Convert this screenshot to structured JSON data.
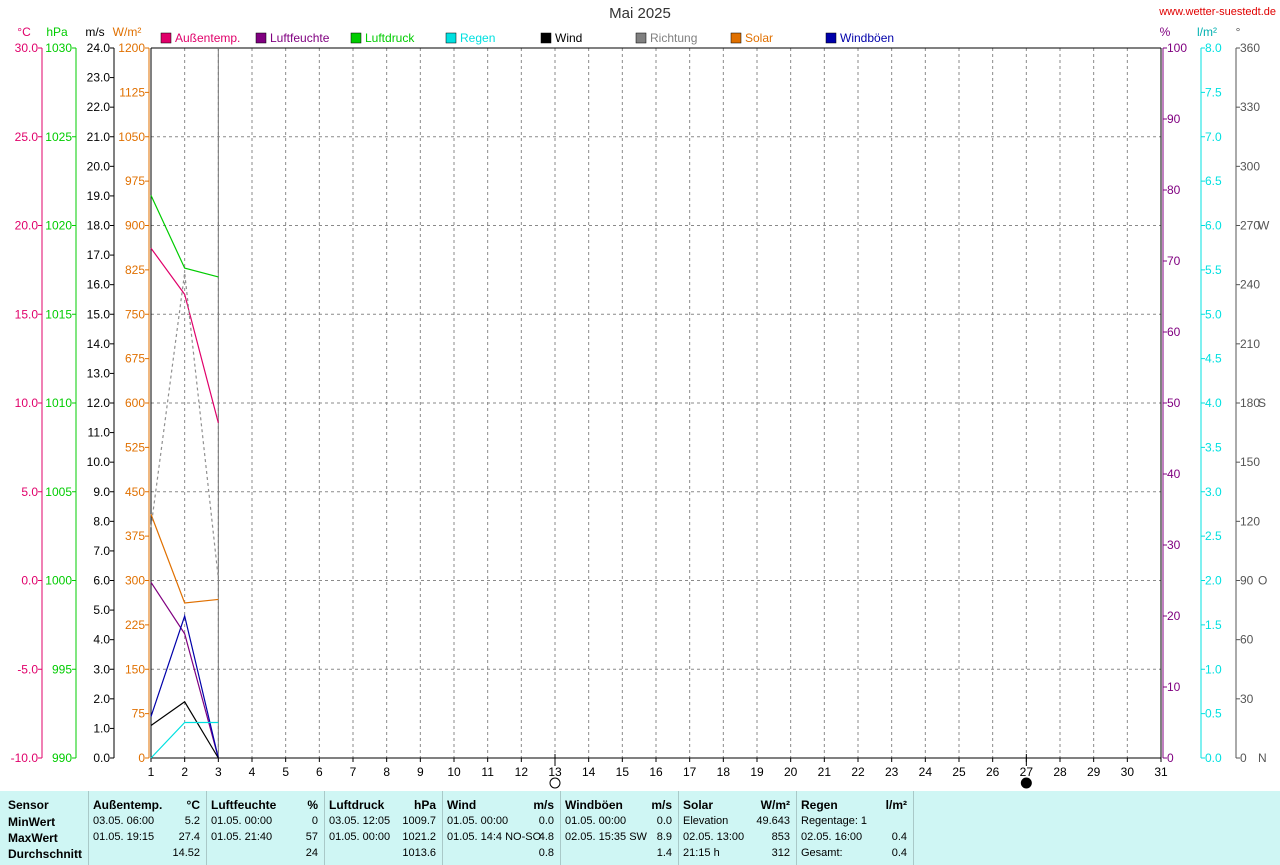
{
  "header": {
    "title": "Mai 2025",
    "site": "www.wetter-suestedt.de"
  },
  "legend": [
    {
      "label": "Außentemp.",
      "color": "#e0006a"
    },
    {
      "label": "Luftfeuchte",
      "color": "#800080"
    },
    {
      "label": "Luftdruck",
      "color": "#00cc00"
    },
    {
      "label": "Regen",
      "color": "#00e0e0"
    },
    {
      "label": "Wind",
      "color": "#000000"
    },
    {
      "label": "Richtung",
      "color": "#808080"
    },
    {
      "label": "Solar",
      "color": "#e07000"
    },
    {
      "label": "Windböen",
      "color": "#0000aa"
    }
  ],
  "axis_units": {
    "temp": "°C",
    "pressure": "hPa",
    "wind": "m/s",
    "solar": "W/m²",
    "humidity": "%",
    "rain": "l/m²",
    "direction": "°"
  },
  "chart_data": {
    "type": "line",
    "title": "Mai 2025",
    "x": [
      1,
      2,
      3
    ],
    "xlim": [
      1,
      31
    ],
    "x_ticks": [
      1,
      2,
      3,
      4,
      5,
      6,
      7,
      8,
      9,
      10,
      11,
      12,
      13,
      14,
      15,
      16,
      17,
      18,
      19,
      20,
      21,
      22,
      23,
      24,
      25,
      26,
      27,
      28,
      29,
      30,
      31
    ],
    "axes": {
      "temp": {
        "range": [
          -10,
          30
        ],
        "ticks": [
          "-10.0",
          "-5.0",
          "0.0",
          "5.0",
          "10.0",
          "15.0",
          "20.0",
          "25.0",
          "30.0"
        ],
        "color": "#e0006a"
      },
      "pressure": {
        "range": [
          990,
          1030
        ],
        "ticks": [
          "990",
          "995",
          "1000",
          "1005",
          "1010",
          "1015",
          "1020",
          "1025",
          "1030"
        ],
        "color": "#00cc00"
      },
      "wind": {
        "range": [
          0,
          24
        ],
        "ticks": [
          "0.0",
          "1.0",
          "2.0",
          "3.0",
          "4.0",
          "5.0",
          "6.0",
          "7.0",
          "8.0",
          "9.0",
          "10.0",
          "11.0",
          "12.0",
          "13.0",
          "14.0",
          "15.0",
          "16.0",
          "17.0",
          "18.0",
          "19.0",
          "20.0",
          "21.0",
          "22.0",
          "23.0",
          "24.0"
        ],
        "color": "#000000"
      },
      "solar": {
        "range": [
          0,
          1200
        ],
        "ticks": [
          "0",
          "75",
          "150",
          "225",
          "300",
          "375",
          "450",
          "525",
          "600",
          "675",
          "750",
          "825",
          "900",
          "975",
          "1050",
          "1125",
          "1200"
        ],
        "color": "#e07000"
      },
      "humidity": {
        "range": [
          0,
          100
        ],
        "ticks": [
          "0",
          "10",
          "20",
          "30",
          "40",
          "50",
          "60",
          "70",
          "80",
          "90",
          "100"
        ],
        "color": "#800080"
      },
      "rain": {
        "range": [
          0,
          8
        ],
        "ticks": [
          "0.0",
          "0.5",
          "1.0",
          "1.5",
          "2.0",
          "2.5",
          "3.0",
          "3.5",
          "4.0",
          "4.5",
          "5.0",
          "5.5",
          "6.0",
          "6.5",
          "7.0",
          "7.5",
          "8.0"
        ],
        "color": "#00e0e0"
      },
      "direction": {
        "range": [
          0,
          360
        ],
        "ticks": [
          "0",
          "30",
          "60",
          "90",
          "120",
          "150",
          "180",
          "210",
          "240",
          "270",
          "300",
          "330",
          "360"
        ],
        "labels": {
          "0": "N",
          "90": "O",
          "180": "S",
          "270": "W"
        },
        "color": "#555555"
      }
    },
    "series": [
      {
        "name": "Luftfeuchte",
        "axis": "humidity",
        "color": "#e0006a",
        "x": [
          1,
          2,
          3
        ],
        "values": [
          71.8,
          65.3,
          47.2
        ]
      },
      {
        "name": "Außentemp.",
        "axis": "temp",
        "color": "#800080",
        "x": [
          1,
          2,
          3
        ],
        "values": [
          -0.1,
          -3.0,
          -10.0
        ]
      },
      {
        "name": "Luftdruck",
        "axis": "pressure",
        "color": "#00cc00",
        "x": [
          1,
          2,
          3
        ],
        "values": [
          1021.7,
          1017.6,
          1017.1
        ]
      },
      {
        "name": "Solar",
        "axis": "solar",
        "color": "#e07000",
        "x": [
          1,
          2,
          3
        ],
        "values": [
          412,
          262,
          268
        ]
      },
      {
        "name": "Windböen",
        "axis": "wind",
        "color": "#0000aa",
        "x": [
          1,
          2,
          3
        ],
        "values": [
          1.4,
          4.8,
          0.0
        ]
      },
      {
        "name": "Wind",
        "axis": "wind",
        "color": "#000000",
        "x": [
          1,
          2,
          3
        ],
        "values": [
          1.1,
          1.9,
          0.0
        ]
      },
      {
        "name": "Richtung",
        "axis": "direction",
        "color": "#909090",
        "dashed": true,
        "x": [
          1,
          2,
          3
        ],
        "values": [
          117,
          246,
          91
        ]
      },
      {
        "name": "Regen",
        "axis": "rain",
        "color": "#00e0e0",
        "x": [
          1,
          2,
          2,
          3
        ],
        "values": [
          0.0,
          0.4,
          0.4,
          0.4
        ]
      }
    ],
    "moon": [
      {
        "day": 13,
        "phase": "full"
      },
      {
        "day": 27,
        "phase": "new"
      }
    ],
    "grid": true
  },
  "table": {
    "row_labels": [
      "Sensor",
      "MinWert",
      "MaxWert",
      "Durchschnitt"
    ],
    "cols": [
      {
        "title": "Außentemp.",
        "unit": "°C",
        "rows": [
          [
            "03.05.  06:00",
            "5.2"
          ],
          [
            "01.05.  19:15",
            "27.4"
          ],
          [
            "",
            "14.52"
          ]
        ]
      },
      {
        "title": "Luftfeuchte",
        "unit": "%",
        "rows": [
          [
            "01.05.  00:00",
            "0"
          ],
          [
            "01.05.  21:40",
            "57"
          ],
          [
            "",
            "24"
          ]
        ]
      },
      {
        "title": "Luftdruck",
        "unit": "hPa",
        "rows": [
          [
            "03.05.  12:05",
            "1009.7"
          ],
          [
            "01.05.  00:00",
            "1021.2"
          ],
          [
            "",
            "1013.6"
          ]
        ]
      },
      {
        "title": "Wind",
        "unit": "m/s",
        "rows": [
          [
            "01.05.  00:00",
            "0.0"
          ],
          [
            "01.05.  14:4 NO-SO",
            "4.8"
          ],
          [
            "",
            "0.8"
          ]
        ]
      },
      {
        "title": "Windböen",
        "unit": "m/s",
        "rows": [
          [
            "01.05.  00:00",
            "0.0"
          ],
          [
            "02.05.  15:35  SW",
            "8.9"
          ],
          [
            "",
            "1.4"
          ]
        ]
      },
      {
        "title": "Solar",
        "unit": "W/m²",
        "rows": [
          [
            "Elevation",
            "49.643"
          ],
          [
            "02.05.  13:00",
            "853"
          ],
          [
            "21:15 h",
            "312"
          ]
        ]
      },
      {
        "title": "Regen",
        "unit": "l/m²",
        "rows": [
          [
            "Regentage: 1",
            ""
          ],
          [
            "02.05.  16:00",
            "0.4"
          ],
          [
            "Gesamt:",
            "0.4"
          ]
        ]
      }
    ]
  }
}
